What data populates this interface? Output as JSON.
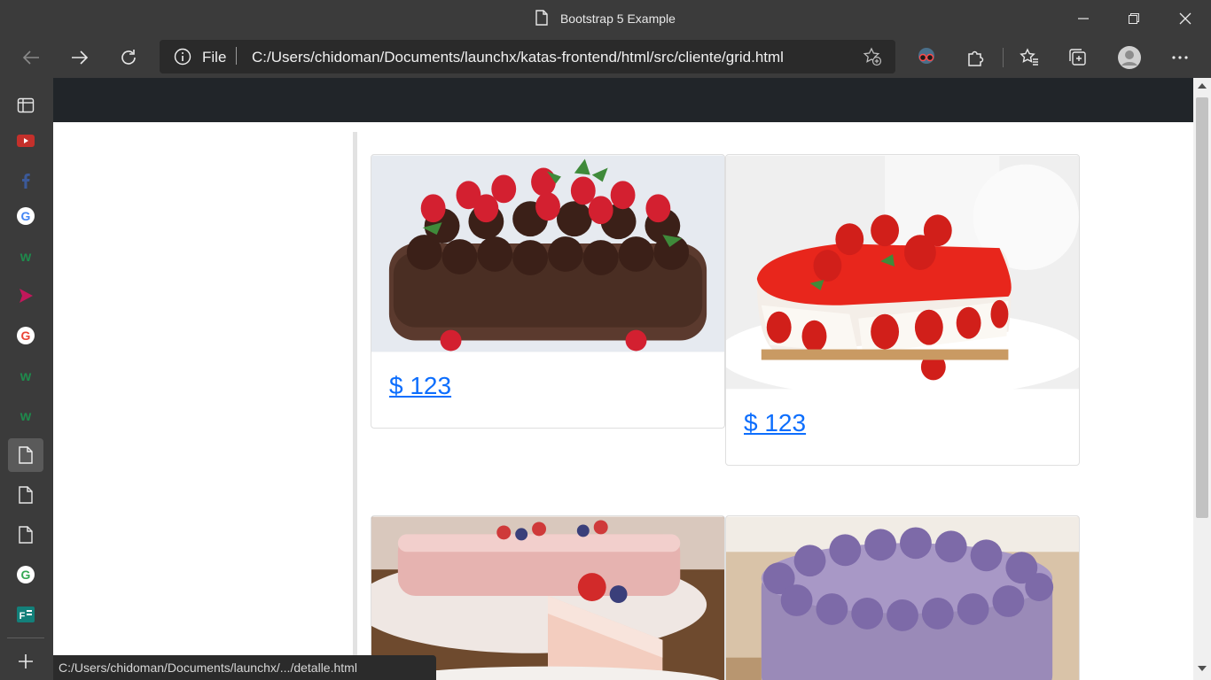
{
  "window": {
    "title": "Bootstrap 5 Example"
  },
  "toolbar": {
    "address_scheme": "File",
    "address_url": "C:/Users/chidoman/Documents/launchx/katas-frontend/html/src/cliente/grid.html"
  },
  "sidebar": {
    "tabs": [
      {
        "icon": "sidebar-toggle-icon"
      },
      {
        "icon": "youtube-icon"
      },
      {
        "icon": "facebook-icon"
      },
      {
        "icon": "google-icon"
      },
      {
        "icon": "w-site-icon"
      },
      {
        "icon": "play-icon"
      },
      {
        "icon": "google-icon"
      },
      {
        "icon": "w-site-icon"
      },
      {
        "icon": "w-site-icon"
      },
      {
        "icon": "page-icon",
        "active": true
      },
      {
        "icon": "page-icon"
      },
      {
        "icon": "page-icon"
      },
      {
        "icon": "google-icon"
      },
      {
        "icon": "forms-icon"
      }
    ]
  },
  "products": [
    {
      "price": "$ 123",
      "image": "chocolate-strawberry-cake"
    },
    {
      "price": "$ 123",
      "image": "strawberry-cheesecake"
    },
    {
      "price": "",
      "image": "pink-layer-cake"
    },
    {
      "price": "",
      "image": "purple-frosted-cake"
    }
  ],
  "status_bar": {
    "url": "C:/Users/chidoman/Documents/launchx/.../detalle.html"
  },
  "colors": {
    "chrome": "#3b3b3b",
    "navbar": "#212529",
    "link": "#0d6efd"
  }
}
